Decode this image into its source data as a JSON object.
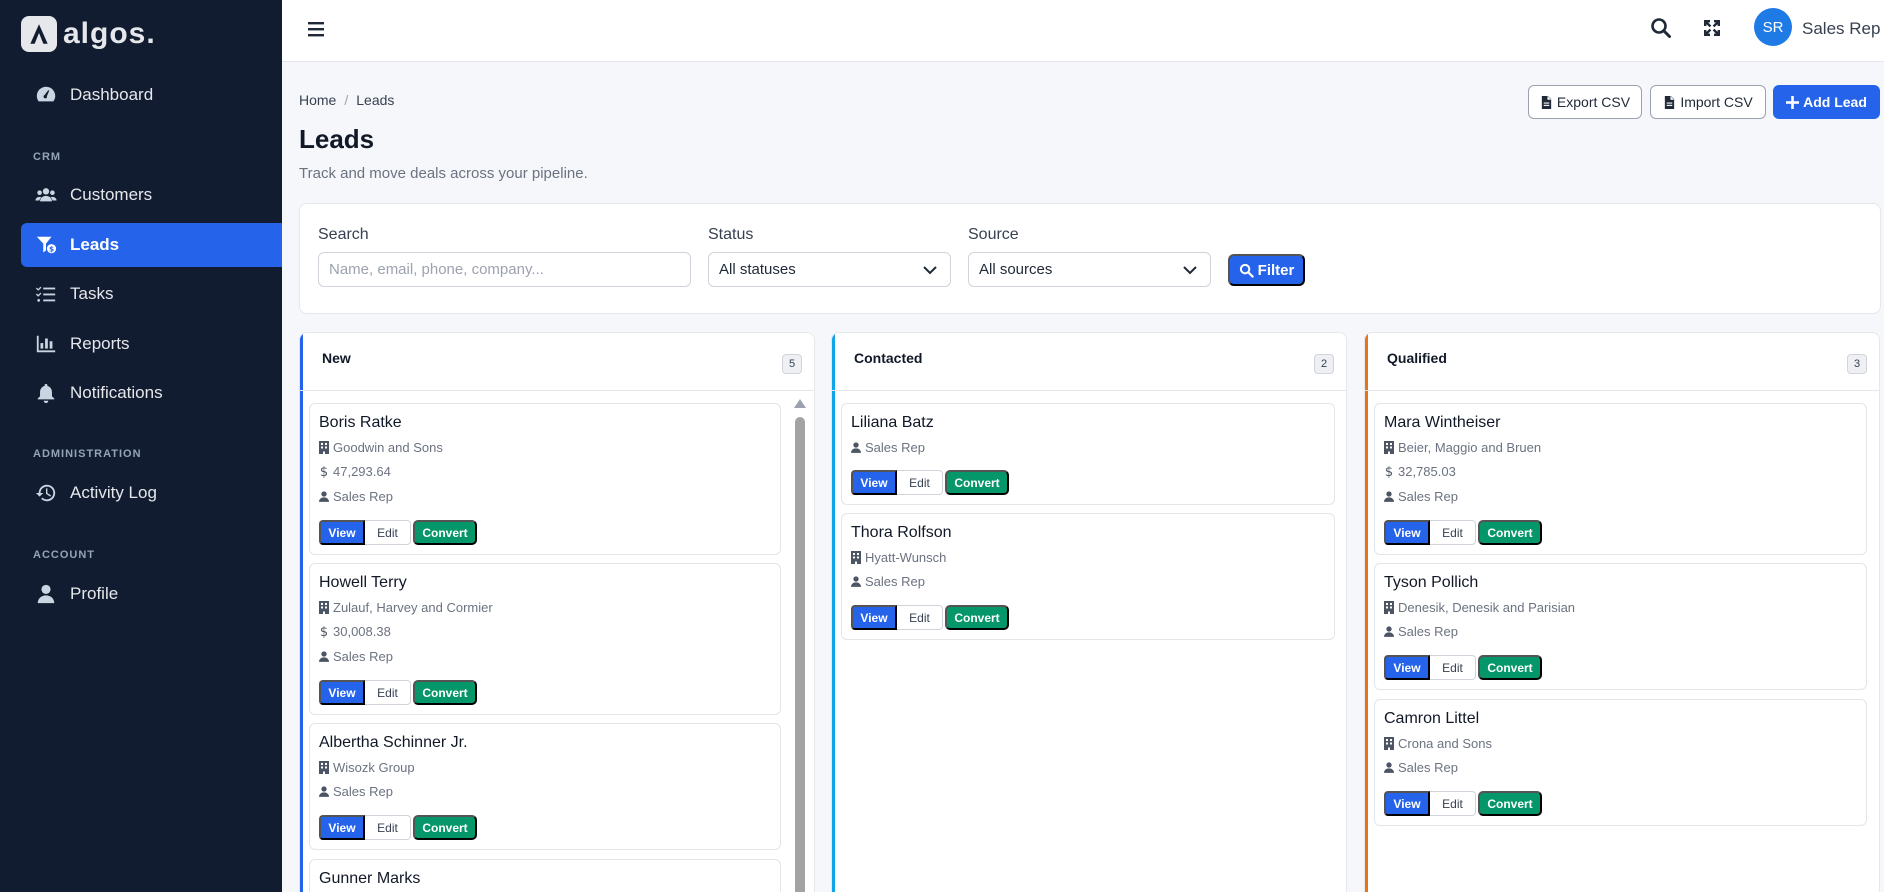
{
  "brand": {
    "name": "algos."
  },
  "sidebar": {
    "dashboard": "Dashboard",
    "section_crm": "CRM",
    "customers": "Customers",
    "leads": "Leads",
    "tasks": "Tasks",
    "reports": "Reports",
    "notifications": "Notifications",
    "section_admin": "ADMINISTRATION",
    "activity_log": "Activity Log",
    "section_account": "ACCOUNT",
    "profile": "Profile"
  },
  "topbar": {
    "avatar_initials": "SR",
    "user_name": "Sales Rep"
  },
  "breadcrumb": {
    "home": "Home",
    "sep": "/",
    "current": "Leads"
  },
  "page": {
    "title": "Leads",
    "subtitle": "Track and move deals across your pipeline."
  },
  "actions": {
    "export": "Export CSV",
    "import": "Import CSV",
    "add": "Add Lead"
  },
  "filters": {
    "search_label": "Search",
    "search_placeholder": "Name, email, phone, company...",
    "status_label": "Status",
    "status_value": "All statuses",
    "source_label": "Source",
    "source_value": "All sources",
    "filter_button": "Filter"
  },
  "card_buttons": {
    "view": "View",
    "edit": "Edit",
    "convert": "Convert"
  },
  "columns": [
    {
      "title": "New",
      "count": "5",
      "accent": "#2563eb",
      "cards": [
        {
          "name": "Boris Ratke",
          "company": "Goodwin and Sons",
          "value": "47,293.64",
          "owner": "Sales Rep"
        },
        {
          "name": "Howell Terry",
          "company": "Zulauf, Harvey and Cormier",
          "value": "30,008.38",
          "owner": "Sales Rep"
        },
        {
          "name": "Albertha Schinner Jr.",
          "company": "Wisozk Group",
          "owner": "Sales Rep"
        },
        {
          "name": "Gunner Marks"
        }
      ]
    },
    {
      "title": "Contacted",
      "count": "2",
      "accent": "#0ea5e9",
      "cards": [
        {
          "name": "Liliana Batz",
          "owner": "Sales Rep"
        },
        {
          "name": "Thora Rolfson",
          "company": "Hyatt-Wunsch",
          "owner": "Sales Rep"
        }
      ]
    },
    {
      "title": "Qualified",
      "count": "3",
      "accent": "#ea7317",
      "cards": [
        {
          "name": "Mara Wintheiser",
          "company": "Beier, Maggio and Bruen",
          "value": "32,785.03",
          "owner": "Sales Rep"
        },
        {
          "name": "Tyson Pollich",
          "company": "Denesik, Denesik and Parisian",
          "owner": "Sales Rep"
        },
        {
          "name": "Camron Littel",
          "company": "Crona and Sons",
          "owner": "Sales Rep"
        }
      ]
    }
  ]
}
